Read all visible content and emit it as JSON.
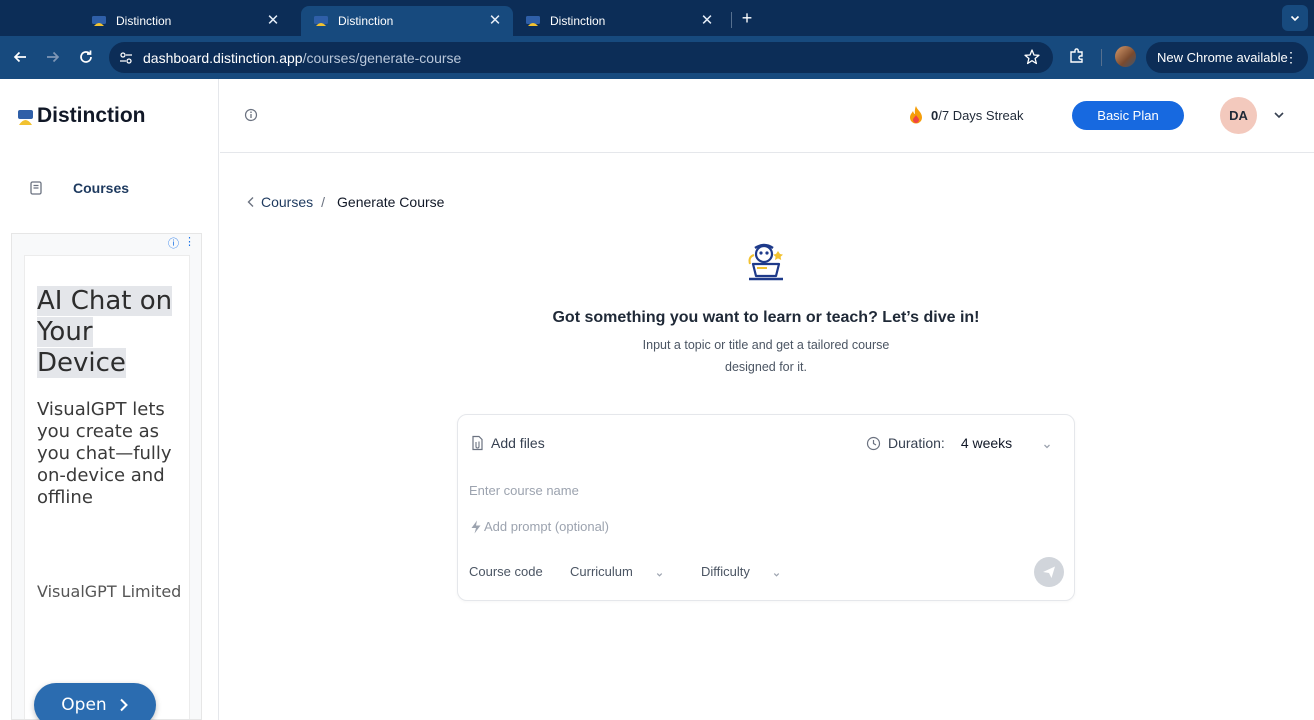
{
  "browser": {
    "tabs": [
      {
        "title": "Distinction",
        "active": false
      },
      {
        "title": "Distinction",
        "active": true
      },
      {
        "title": "Distinction",
        "active": false
      }
    ],
    "url_host": "dashboard.distinction.app",
    "url_path": "/courses/generate-course",
    "update_label": "New Chrome available",
    "icons": [
      "back-icon",
      "forward-icon",
      "reload-icon",
      "site-settings-icon",
      "bookmark-star-icon",
      "extensions-icon",
      "profile-avatar",
      "more-icon",
      "tab-search-icon",
      "new-tab-icon",
      "close-tab-icon"
    ]
  },
  "sidebar": {
    "logo": "Distinction",
    "nav_items": [
      {
        "label": "Courses",
        "icon": "book-icon"
      }
    ],
    "ad": {
      "headline_lines": [
        "AI Chat on",
        "Your",
        "Device"
      ],
      "body": "VisualGPT lets you create as you chat—fully on-device and offline",
      "advertiser": "VisualGPT Limited",
      "cta": "Open"
    }
  },
  "header": {
    "streak_current": "0",
    "streak_rest": "/7 Days Streak",
    "plan_label": "Basic Plan",
    "avatar_initials": "DA"
  },
  "breadcrumb": {
    "parent": "Courses",
    "separator": "/",
    "current": "Generate Course"
  },
  "hero": {
    "title": "Got something you want to learn or teach? Let’s dive in!",
    "subtitle": "Input a topic or title and get a tailored course designed for it."
  },
  "form": {
    "add_files_label": "Add files",
    "duration_label": "Duration:",
    "duration_value": "4 weeks",
    "course_name_placeholder": "Enter course name",
    "prompt_placeholder": "Add prompt (optional)",
    "course_code_label": "Course code",
    "curriculum_label": "Curriculum",
    "difficulty_label": "Difficulty"
  },
  "colors": {
    "tabstrip": "#0c2d57",
    "toolbar": "#174a7e",
    "primary": "#1769e0",
    "avatar_bg": "#f3c9bd",
    "nav_text": "#1e3a5f"
  }
}
